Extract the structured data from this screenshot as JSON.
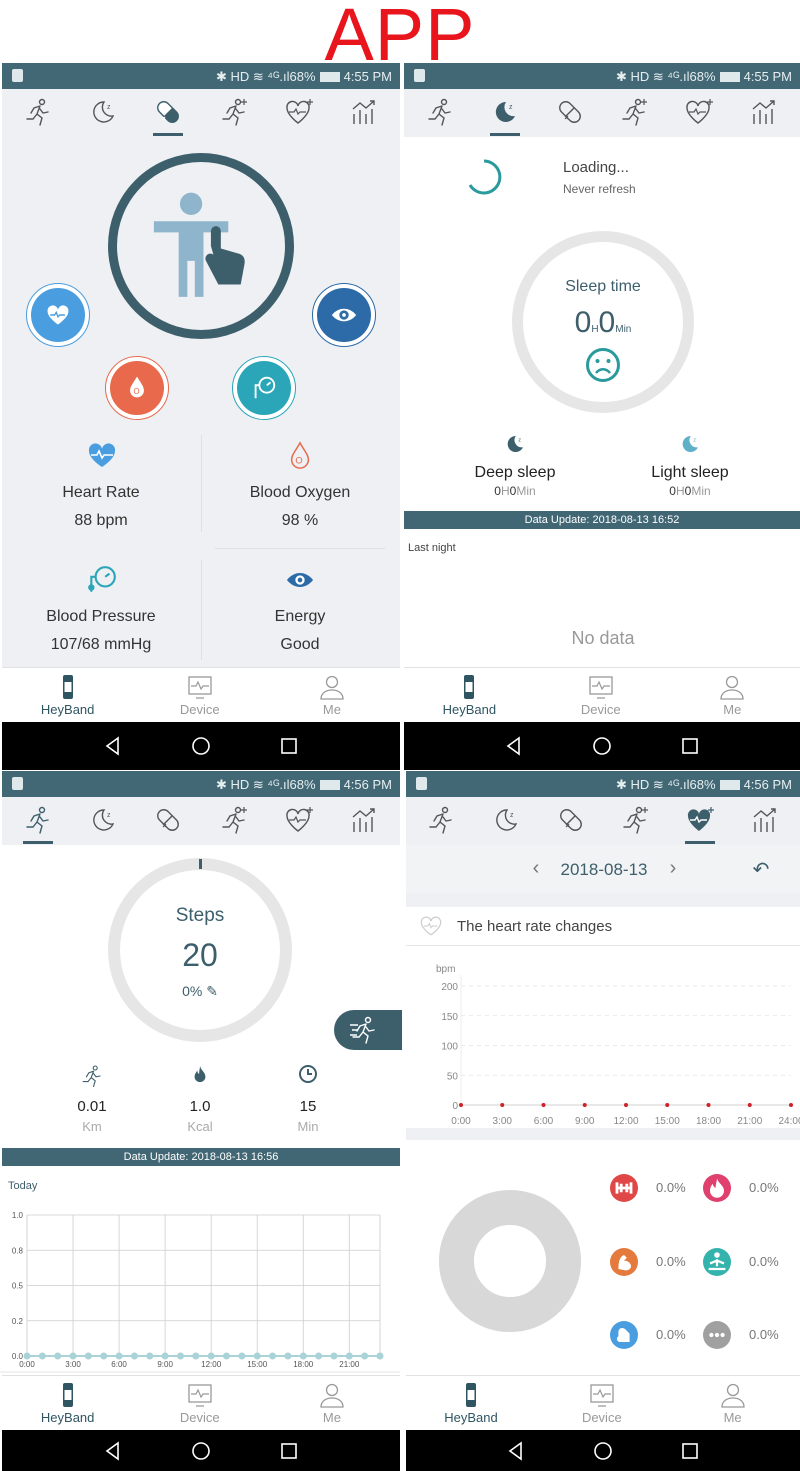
{
  "banner_title": "APP",
  "status_bar": [
    {
      "time": "4:55 PM",
      "battery": "68%",
      "icons": "✱ HD ≋ ⁴ᴳ.ıl"
    },
    {
      "time": "4:55 PM",
      "battery": "68%",
      "icons": "✱ HD ≋ ⁴ᴳ.ıl"
    },
    {
      "time": "4:56 PM",
      "battery": "68%",
      "icons": "✱ HD ≋ ⁴ᴳ.ıl"
    },
    {
      "time": "4:56 PM",
      "battery": "68%",
      "icons": "✱ HD ≋ ⁴ᴳ.ıl"
    }
  ],
  "tabs": [
    "running-icon",
    "sleep-moon-icon",
    "health-pill-icon",
    "exercise-plus-icon",
    "heart-rate-plus-icon",
    "stats-chart-icon"
  ],
  "active_tabs": [
    2,
    1,
    0,
    4
  ],
  "bottom_nav": [
    {
      "label": "HeyBand",
      "icon": "band-icon"
    },
    {
      "label": "Device",
      "icon": "device-icon"
    },
    {
      "label": "Me",
      "icon": "person-icon"
    }
  ],
  "colors": {
    "primary": "#416674",
    "heart": "#4a9ee0",
    "oxygen": "#e8694b",
    "pressure": "#2aa6b8",
    "energy": "#2c6aa8",
    "hr_point": "#d0202a"
  },
  "health": {
    "metrics": [
      {
        "label": "Heart Rate",
        "value": "88 bpm"
      },
      {
        "label": "Blood Oxygen",
        "value": "98 %"
      },
      {
        "label": "Blood Pressure",
        "value": "107/68 mmHg"
      },
      {
        "label": "Energy",
        "value": "Good"
      }
    ]
  },
  "sleep": {
    "loading": "Loading...",
    "never_refresh": "Never refresh",
    "sleep_time_label": "Sleep time",
    "hours": "0",
    "h_unit": "H",
    "minutes": "0",
    "min_unit": "Min",
    "deep": {
      "label": "Deep sleep",
      "h": "0",
      "h_unit": "H",
      "m": "0",
      "m_unit": "Min"
    },
    "light": {
      "label": "Light sleep",
      "h": "0",
      "h_unit": "H",
      "m": "0",
      "m_unit": "Min"
    },
    "data_update": "Data Update: 2018-08-13 16:52",
    "last_night": "Last night",
    "no_data": "No data"
  },
  "steps": {
    "label": "Steps",
    "count": "20",
    "percent": "0%",
    "goal_progress": 0,
    "stats": [
      {
        "value": "0.01",
        "unit": "Km"
      },
      {
        "value": "1.0",
        "unit": "Kcal"
      },
      {
        "value": "15",
        "unit": "Min"
      }
    ],
    "data_update": "Data Update: 2018-08-13 16:56",
    "today": "Today"
  },
  "heart": {
    "date": "2018-08-13",
    "section_title": "The heart rate changes",
    "zones": [
      {
        "icon": "dumbbell-icon",
        "color": "#e04848",
        "value": "0.0%"
      },
      {
        "icon": "flame-icon",
        "color": "#e0406e",
        "value": "0.0%"
      },
      {
        "icon": "muscle-icon",
        "color": "#e47a3c",
        "value": "0.0%"
      },
      {
        "icon": "meditation-icon",
        "color": "#33b3ab",
        "value": "0.0%"
      },
      {
        "icon": "rest-icon",
        "color": "#4a9ee0",
        "value": "0.0%"
      },
      {
        "icon": "more-icon",
        "color": "#a0a0a0",
        "value": "0.0%"
      }
    ]
  },
  "chart_data": [
    {
      "type": "line",
      "title": "Today",
      "x": [
        0,
        1,
        2,
        3,
        4,
        5,
        6,
        7,
        8,
        9,
        10,
        11,
        12,
        13,
        14,
        15,
        16,
        17,
        18,
        19,
        20,
        21,
        22,
        23
      ],
      "values": [
        0,
        0,
        0,
        0,
        0,
        0,
        0,
        0,
        0,
        0,
        0,
        0,
        0,
        0,
        0,
        0,
        0,
        0,
        0,
        0,
        0,
        0,
        0,
        0
      ],
      "x_tick_labels": [
        "0:00",
        "3:00",
        "6:00",
        "9:00",
        "12:00",
        "15:00",
        "18:00",
        "21:00"
      ],
      "y_tick_labels": [
        "0.0",
        "0.2",
        "0.5",
        "0.8",
        "1.0"
      ],
      "xlim": [
        0,
        23
      ],
      "ylim": [
        0,
        1
      ],
      "grid": true,
      "color": "#a9d3d6"
    },
    {
      "type": "scatter",
      "ylabel": "bpm",
      "x": [
        0,
        3,
        6,
        9,
        12,
        15,
        18,
        21,
        24
      ],
      "values": [
        0,
        0,
        0,
        0,
        0,
        0,
        0,
        0,
        0
      ],
      "x_tick_labels": [
        "0:00",
        "3:00",
        "6:00",
        "9:00",
        "12:00",
        "15:00",
        "18:00",
        "21:00",
        "24:00"
      ],
      "y_ticks": [
        0,
        50,
        100,
        150,
        200
      ],
      "xlim": [
        0,
        24
      ],
      "ylim": [
        0,
        200
      ],
      "grid": "dashed",
      "color": "#d0202a"
    },
    {
      "type": "pie",
      "values": [
        0,
        0,
        0,
        0,
        0,
        0
      ],
      "empty": true
    }
  ]
}
